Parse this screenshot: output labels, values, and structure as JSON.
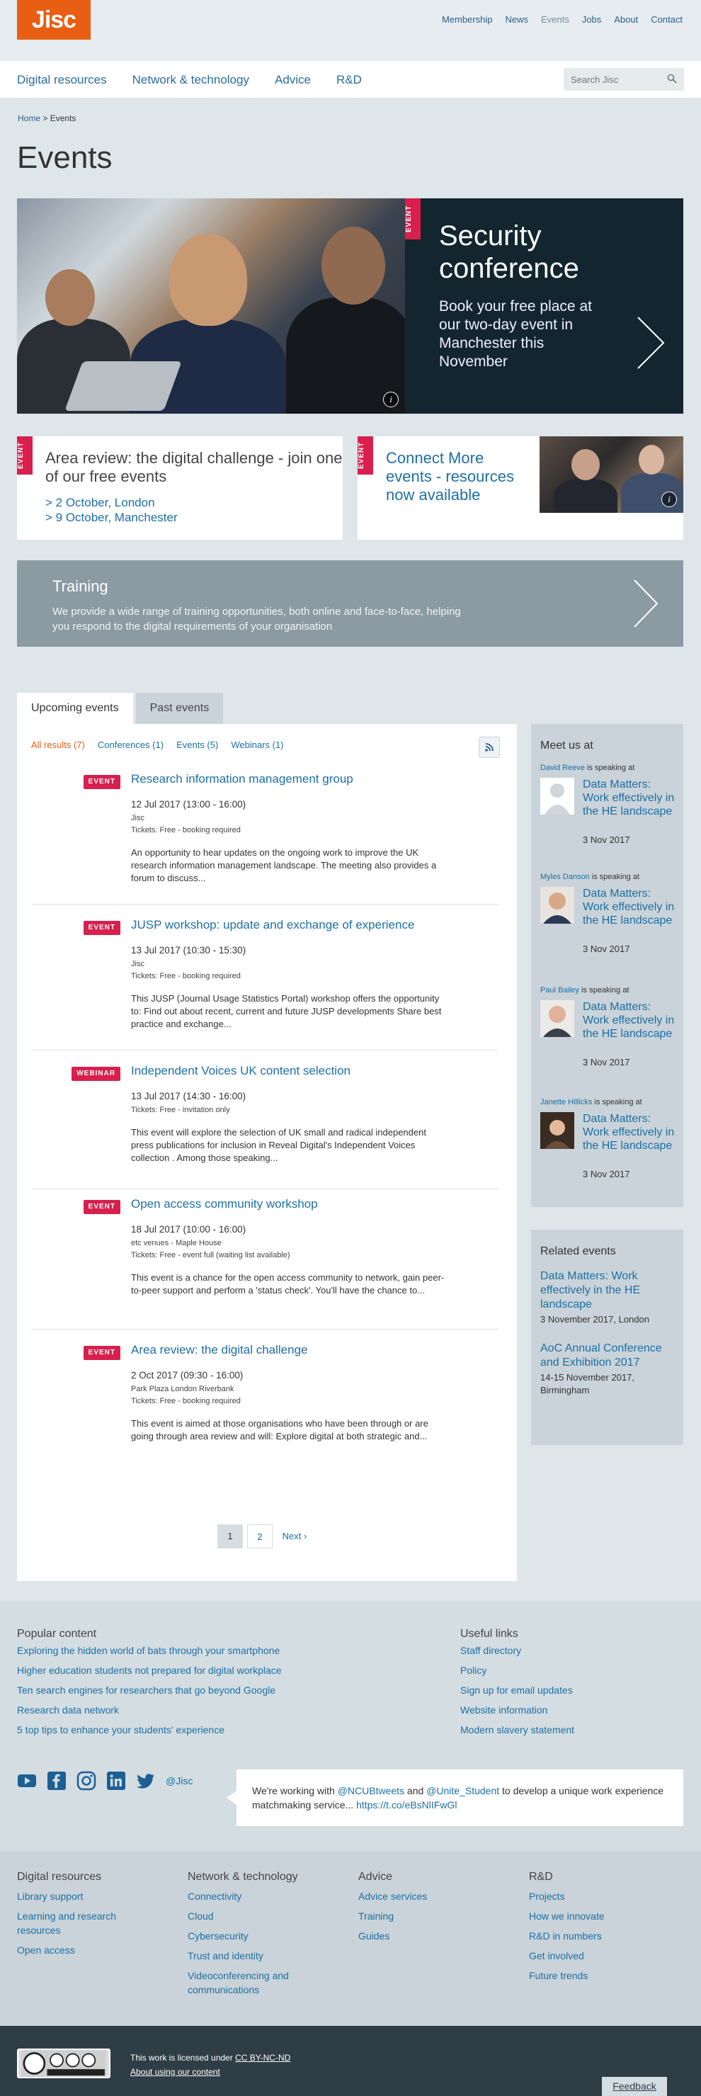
{
  "header": {
    "logo": "Jisc",
    "top_links": [
      "Membership",
      "News",
      "Events",
      "Jobs",
      "About",
      "Contact"
    ],
    "main_nav": [
      "Digital resources",
      "Network & technology",
      "Advice",
      "R&D"
    ],
    "search_placeholder": "Search Jisc"
  },
  "breadcrumb": {
    "home": "Home",
    "sep": ">",
    "current": "Events"
  },
  "page_title": "Events",
  "hero": {
    "tag": "EVENT",
    "title": "Security conference",
    "text": "Book your free place at our two-day event in Manchester this November",
    "info": "i"
  },
  "cards": [
    {
      "tag": "EVENT",
      "title": "Area review: the digital challenge - join one of our free events",
      "dates": [
        "> 2 October, London",
        "> 9 October, Manchester"
      ]
    },
    {
      "tag": "EVENT",
      "title": "Connect More events - resources now available",
      "info": "i"
    }
  ],
  "training": {
    "title": "Training",
    "text": "We provide a wide range of training opportunities, both online and face-to-face, helping you respond to the digital requirements of your organisation"
  },
  "tabs": [
    "Upcoming events",
    "Past events"
  ],
  "filters": [
    "All results  (7)",
    "Conferences  (1)",
    "Events  (5)",
    "Webinars  (1)"
  ],
  "events": [
    {
      "badge": "EVENT",
      "title": "Research information management group",
      "when": "12 Jul 2017 (13:00 - 16:00)",
      "venue": "Jisc",
      "tickets": "Tickets: Free - booking required",
      "desc": "An opportunity to hear updates on the ongoing work to improve the UK research information management landscape. The meeting also provides a forum to discuss..."
    },
    {
      "badge": "EVENT",
      "title": "JUSP workshop: update and exchange of experience",
      "when": "13 Jul 2017 (10:30 - 15:30)",
      "venue": "Jisc",
      "tickets": "Tickets: Free - booking required",
      "desc": "This JUSP (Journal Usage Statistics Portal) workshop offers the opportunity to: Find out about recent, current and future JUSP developments Share best practice and exchange..."
    },
    {
      "badge": "WEBINAR",
      "title": "Independent Voices UK content selection",
      "when": "13 Jul 2017 (14:30 - 16:00)",
      "venue": "",
      "tickets": "Tickets: Free - invitation only",
      "desc": "This event will explore the selection of UK small and radical independent press publications for inclusion in Reveal Digital's Independent Voices collection . Among those speaking..."
    },
    {
      "badge": "EVENT",
      "title": "Open access community workshop",
      "when": "18 Jul 2017 (10:00 - 16:00)",
      "venue": "etc venues - Maple House",
      "tickets": "Tickets: Free - event full (waiting list available)",
      "desc": "This event is a chance for the open access community to network, gain peer-to-peer support and perform a 'status check'. You'll have the chance to..."
    },
    {
      "badge": "EVENT",
      "title": "Area review: the digital challenge",
      "when": "2 Oct 2017 (09:30 - 16:00)",
      "venue": "Park Plaza London Riverbank",
      "tickets": "Tickets: Free - booking required",
      "desc": "This event is aimed at those organisations who have been through or are going through area review and will: Explore digital at both strategic and..."
    }
  ],
  "pager": {
    "current": "1",
    "page2": "2",
    "next": "Next ›"
  },
  "meet": {
    "title": "Meet us at",
    "speaking": "is speaking at",
    "speakers": [
      {
        "name": "David Reeve",
        "event": "Data Matters: Work effectively in the HE landscape",
        "date": "3 Nov 2017"
      },
      {
        "name": "Myles Danson",
        "event": "Data Matters: Work effectively in the HE landscape",
        "date": "3 Nov 2017"
      },
      {
        "name": "Paul Bailey",
        "event": "Data Matters: Work effectively in the HE landscape",
        "date": "3 Nov 2017"
      },
      {
        "name": "Janette Hillicks",
        "event": "Data Matters: Work effectively in the HE landscape",
        "date": "3 Nov 2017"
      }
    ]
  },
  "related": {
    "title": "Related events",
    "items": [
      {
        "title": "Data Matters: Work effectively in the HE landscape",
        "detail": "3 November 2017, London"
      },
      {
        "title": "AoC Annual Conference and Exhibition 2017",
        "detail": "14-15 November 2017, Birmingham"
      }
    ]
  },
  "footer": {
    "popular_title": "Popular content",
    "popular": [
      "Exploring the hidden world of bats through your smartphone",
      "Higher education students not prepared for digital workplace",
      "Ten search engines for researchers that go beyond Google",
      "Research data network",
      "5 top tips to enhance your students' experience"
    ],
    "useful_title": "Useful links",
    "useful": [
      "Staff directory",
      "Policy",
      "Sign up for email updates",
      "Website information",
      "Modern slavery statement"
    ],
    "handle": "@Jisc",
    "tweet_pre": "We're working with ",
    "tweet_h1": "@NCUBtweets",
    "tweet_mid": " and ",
    "tweet_h2": "@Unite_Student",
    "tweet_post": " to develop a unique work experience matchmaking service... ",
    "tweet_link": "https://t.co/eBsNlIFwGl",
    "columns": [
      {
        "title": "Digital resources",
        "links": [
          "Library support",
          "Learning and research resources",
          "Open access"
        ]
      },
      {
        "title": "Network & technology",
        "links": [
          "Connectivity",
          "Cloud",
          "Cybersecurity",
          "Trust and identity",
          "Videoconferencing and communications"
        ]
      },
      {
        "title": "Advice",
        "links": [
          "Advice services",
          "Training",
          "Guides"
        ]
      },
      {
        "title": "R&D",
        "links": [
          "Projects",
          "How we innovate",
          "R&D in numbers",
          "Get involved",
          "Future trends"
        ]
      }
    ],
    "license_pre": "This work is licensed under ",
    "license_link": "CC BY-NC-ND",
    "about_content": "About using our content",
    "feedback": "Feedback"
  },
  "colors": {
    "brand": "#e85e13",
    "accent": "#d81f4d",
    "link": "#1d6fa5",
    "dark_panel": "#13262f"
  }
}
